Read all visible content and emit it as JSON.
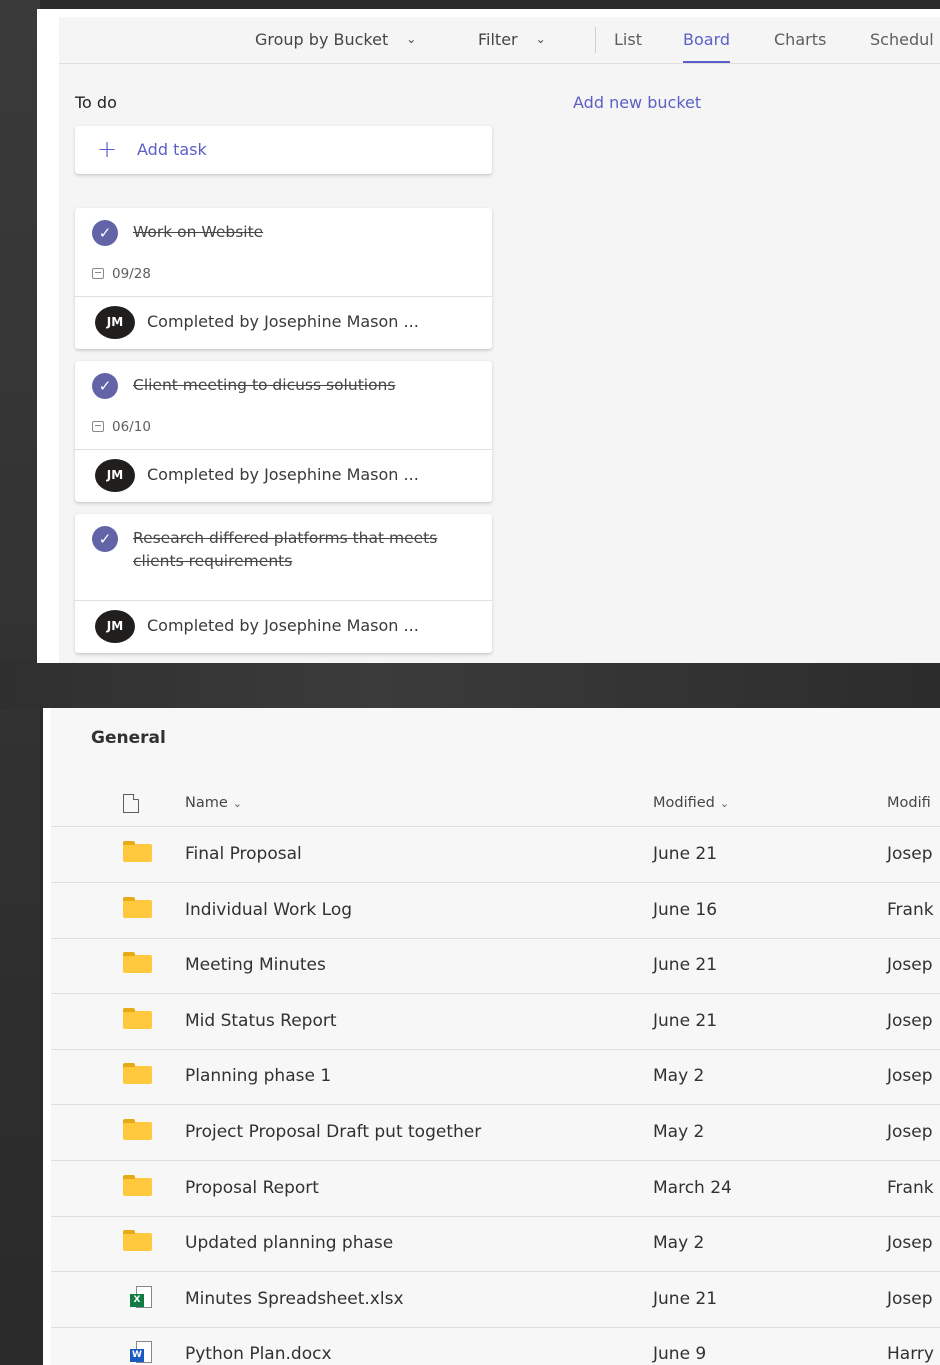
{
  "planner": {
    "toolbar": {
      "group_by": "Group by Bucket",
      "filter": "Filter",
      "tabs": [
        {
          "label": "List",
          "active": false
        },
        {
          "label": "Board",
          "active": true
        },
        {
          "label": "Charts",
          "active": false
        },
        {
          "label": "Schedul",
          "active": false
        }
      ]
    },
    "bucket": {
      "title": "To do",
      "add_task": "Add task"
    },
    "add_new_bucket": "Add new bucket",
    "cards": [
      {
        "title": "Work on Website",
        "due": "09/28",
        "avatar": "JM",
        "completed_by": "Completed by Josephine Mason ..."
      },
      {
        "title": "Client meeting to dicuss solutions",
        "due": "06/10",
        "avatar": "JM",
        "completed_by": "Completed by Josephine Mason ..."
      },
      {
        "title": "Research differed platforms that meets clients requirements",
        "due": "",
        "avatar": "JM",
        "completed_by": "Completed by Josephine Mason ..."
      }
    ],
    "accent_color": "#5b5fc7"
  },
  "files": {
    "title": "General",
    "columns": {
      "name": "Name",
      "modified": "Modified",
      "modified_by": "Modifi"
    },
    "rows": [
      {
        "type": "folder",
        "name": "Final Proposal",
        "modified": "June 21",
        "modified_by": "Josep"
      },
      {
        "type": "folder",
        "name": "Individual Work Log",
        "modified": "June 16",
        "modified_by": "Frank"
      },
      {
        "type": "folder",
        "name": "Meeting Minutes",
        "modified": "June 21",
        "modified_by": "Josep"
      },
      {
        "type": "folder",
        "name": "Mid Status Report",
        "modified": "June 21",
        "modified_by": "Josep"
      },
      {
        "type": "folder",
        "name": "Planning phase 1",
        "modified": "May 2",
        "modified_by": "Josep"
      },
      {
        "type": "folder",
        "name": "Project Proposal Draft put together",
        "modified": "May 2",
        "modified_by": "Josep"
      },
      {
        "type": "folder",
        "name": "Proposal Report",
        "modified": "March 24",
        "modified_by": "Frank"
      },
      {
        "type": "folder",
        "name": "Updated planning phase",
        "modified": "May 2",
        "modified_by": "Josep"
      },
      {
        "type": "xlsx",
        "name": "Minutes Spreadsheet.xlsx",
        "modified": "June 21",
        "modified_by": "Josep"
      },
      {
        "type": "docx",
        "name": "Python Plan.docx",
        "modified": "June 9",
        "modified_by": "Harry"
      }
    ],
    "folder_color": "#ffc83d"
  }
}
